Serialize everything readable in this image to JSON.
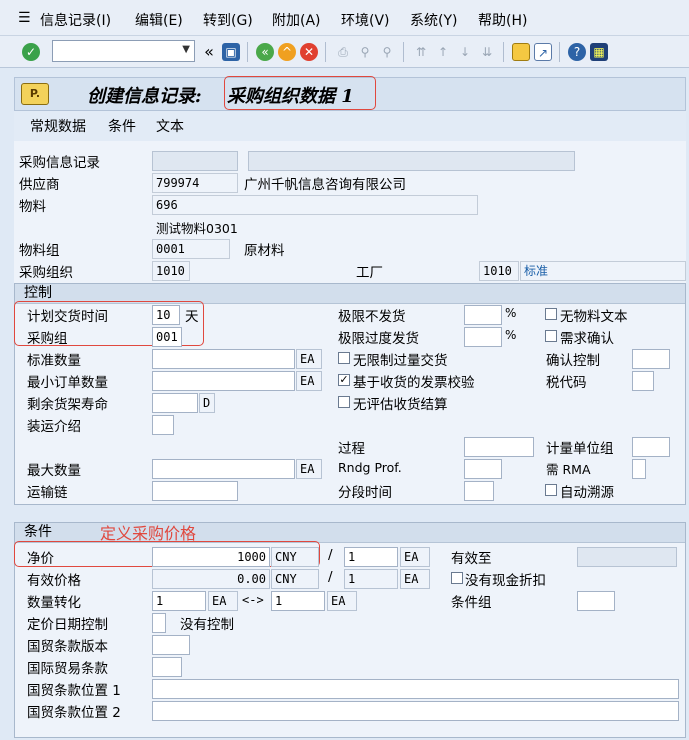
{
  "menu": [
    {
      "label": "信息记录(I)"
    },
    {
      "label": "编辑(E)"
    },
    {
      "label": "转到(G)"
    },
    {
      "label": "附加(A)"
    },
    {
      "label": "环境(V)"
    },
    {
      "label": "系统(Y)"
    },
    {
      "label": "帮助(H)"
    }
  ],
  "toolbar": {
    "command_value": "",
    "back_glyph": "«"
  },
  "title": {
    "prefix": "创建信息记录:",
    "screen": "采购组织数据 1"
  },
  "subtabs": [
    "常规数据",
    "条件",
    "文本"
  ],
  "header": {
    "info_record": {
      "label": "采购信息记录",
      "value": "",
      "desc": ""
    },
    "vendor": {
      "label": "供应商",
      "value": "799974",
      "desc": "广州千帆信息咨询有限公司"
    },
    "material": {
      "label": "物料",
      "value": "696",
      "desc": "测试物料0301"
    },
    "material_group": {
      "label": "物料组",
      "value": "0001",
      "desc": "原材料"
    },
    "purch_org": {
      "label": "采购组织",
      "value": "1010"
    },
    "plant": {
      "label": "工厂",
      "value": "1010",
      "desc": "标准"
    }
  },
  "control": {
    "title": "控制",
    "planned_delivery": {
      "label": "计划交货时间",
      "value": "10",
      "unit": "天"
    },
    "purch_group": {
      "label": "采购组",
      "value": "001"
    },
    "standard_qty": {
      "label": "标准数量",
      "value": "",
      "unit": "EA"
    },
    "min_order_qty": {
      "label": "最小订单数量",
      "value": "",
      "unit": "EA"
    },
    "rem_shelf_life": {
      "label": "剩余货架寿命",
      "value": "",
      "unit": "D"
    },
    "shipping_instr": {
      "label": "装运介绍",
      "value": ""
    },
    "max_qty": {
      "label": "最大数量",
      "value": "",
      "unit": "EA"
    },
    "conf_chain": {
      "label": "运输链",
      "value": ""
    },
    "underdel_tol": {
      "label": "极限不发货",
      "value": "",
      "unit": "%"
    },
    "overdel_tol": {
      "label": "极限过度发货",
      "value": "",
      "unit": "%"
    },
    "unlimited": {
      "label": "无限制过量交货",
      "checked": false
    },
    "gr_based_iv": {
      "label": "基于收货的发票校验",
      "checked": true
    },
    "no_eval_gr": {
      "label": "无评估收货结算",
      "checked": false
    },
    "procedure": {
      "label": "过程",
      "value": ""
    },
    "rndg_prof": {
      "label": "Rndg Prof.",
      "value": ""
    },
    "period_ind": {
      "label": "分段时间",
      "value": ""
    },
    "no_mat_text": {
      "label": "无物料文本",
      "checked": false
    },
    "ack_reqd": {
      "label": "需求确认",
      "checked": false
    },
    "conf_ctrl": {
      "label": "确认控制",
      "value": ""
    },
    "tax_code": {
      "label": "税代码",
      "value": ""
    },
    "uom_group": {
      "label": "计量单位组",
      "value": ""
    },
    "rma": {
      "label": "需 RMA",
      "value": ""
    },
    "auto_source": {
      "label": "自动溯源",
      "checked": false
    }
  },
  "conditions": {
    "title": "条件",
    "annotation": "定义采购价格",
    "net_price": {
      "label": "净价",
      "value": "1000",
      "currency": "CNY",
      "per": "1",
      "unit": "EA"
    },
    "eff_price": {
      "label": "有效价格",
      "value": "0.00",
      "currency": "CNY",
      "per": "1",
      "unit": "EA"
    },
    "conversion": {
      "label": "数量转化",
      "qty1": "1",
      "unit1": "EA",
      "arrow": "<->",
      "qty2": "1",
      "unit2": "EA"
    },
    "price_date_ctrl": {
      "label": "定价日期控制",
      "value": "",
      "desc": "没有控制"
    },
    "incoterms_version": {
      "label": "国贸条款版本",
      "value": ""
    },
    "incoterms": {
      "label": "国际贸易条款",
      "value": ""
    },
    "incoterms_loc1": {
      "label": "国贸条款位置 1",
      "value": ""
    },
    "incoterms_loc2": {
      "label": "国贸条款位置 2",
      "value": ""
    },
    "valid_to": {
      "label": "有效至",
      "value": ""
    },
    "no_cash_disc": {
      "label": "没有现金折扣",
      "checked": false
    },
    "cond_group": {
      "label": "条件组",
      "value": ""
    },
    "slash": "/"
  },
  "colors": {
    "annotation": "#e0483e",
    "accent_blue": "#1a5fa8"
  }
}
